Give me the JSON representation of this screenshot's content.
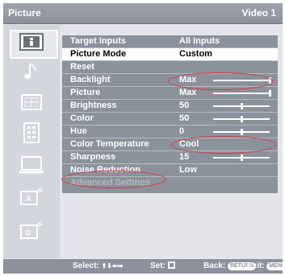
{
  "header": {
    "title": "Picture",
    "input": "Video 1"
  },
  "sidebar": {
    "icons": [
      {
        "name": "picture-icon",
        "selected": true
      },
      {
        "name": "sound-icon"
      },
      {
        "name": "screen-icon"
      },
      {
        "name": "channel-icon"
      },
      {
        "name": "setup-icon"
      },
      {
        "name": "analog-icon",
        "letter": "A"
      },
      {
        "name": "digital-icon",
        "letter": "D"
      }
    ]
  },
  "menu": {
    "rows": [
      {
        "label": "Target Inputs",
        "value": "All Inputs"
      },
      {
        "label": "Picture Mode",
        "value": "Custom",
        "highlight": true
      },
      {
        "label": "Reset",
        "value": ""
      },
      {
        "label": "Backlight",
        "value": "Max",
        "slider": 1.0
      },
      {
        "label": "Picture",
        "value": "Max",
        "slider": 1.0
      },
      {
        "label": "Brightness",
        "value": "50",
        "slider": 0.5
      },
      {
        "label": "Color",
        "value": "50",
        "slider": 0.5
      },
      {
        "label": "Hue",
        "value": "0",
        "slider": 0.5
      },
      {
        "label": "Color Temperature",
        "value": "Cool"
      },
      {
        "label": "Sharpness",
        "value": "15",
        "slider": 0.5
      },
      {
        "label": "Noise Reduction",
        "value": "Low"
      },
      {
        "label": "Advanced Settings",
        "value": "",
        "disabled": true
      }
    ]
  },
  "footer": {
    "select": "Select:",
    "arrows": "⬆⬇⬅➡",
    "set": "Set:",
    "back": "Back:",
    "back_key": "RETURN",
    "exit": "Exit:",
    "exit_key": "MENU"
  },
  "colors": {
    "annotation": "#d8333a",
    "panel": "#8b929b",
    "highlight": "#ffffff"
  }
}
